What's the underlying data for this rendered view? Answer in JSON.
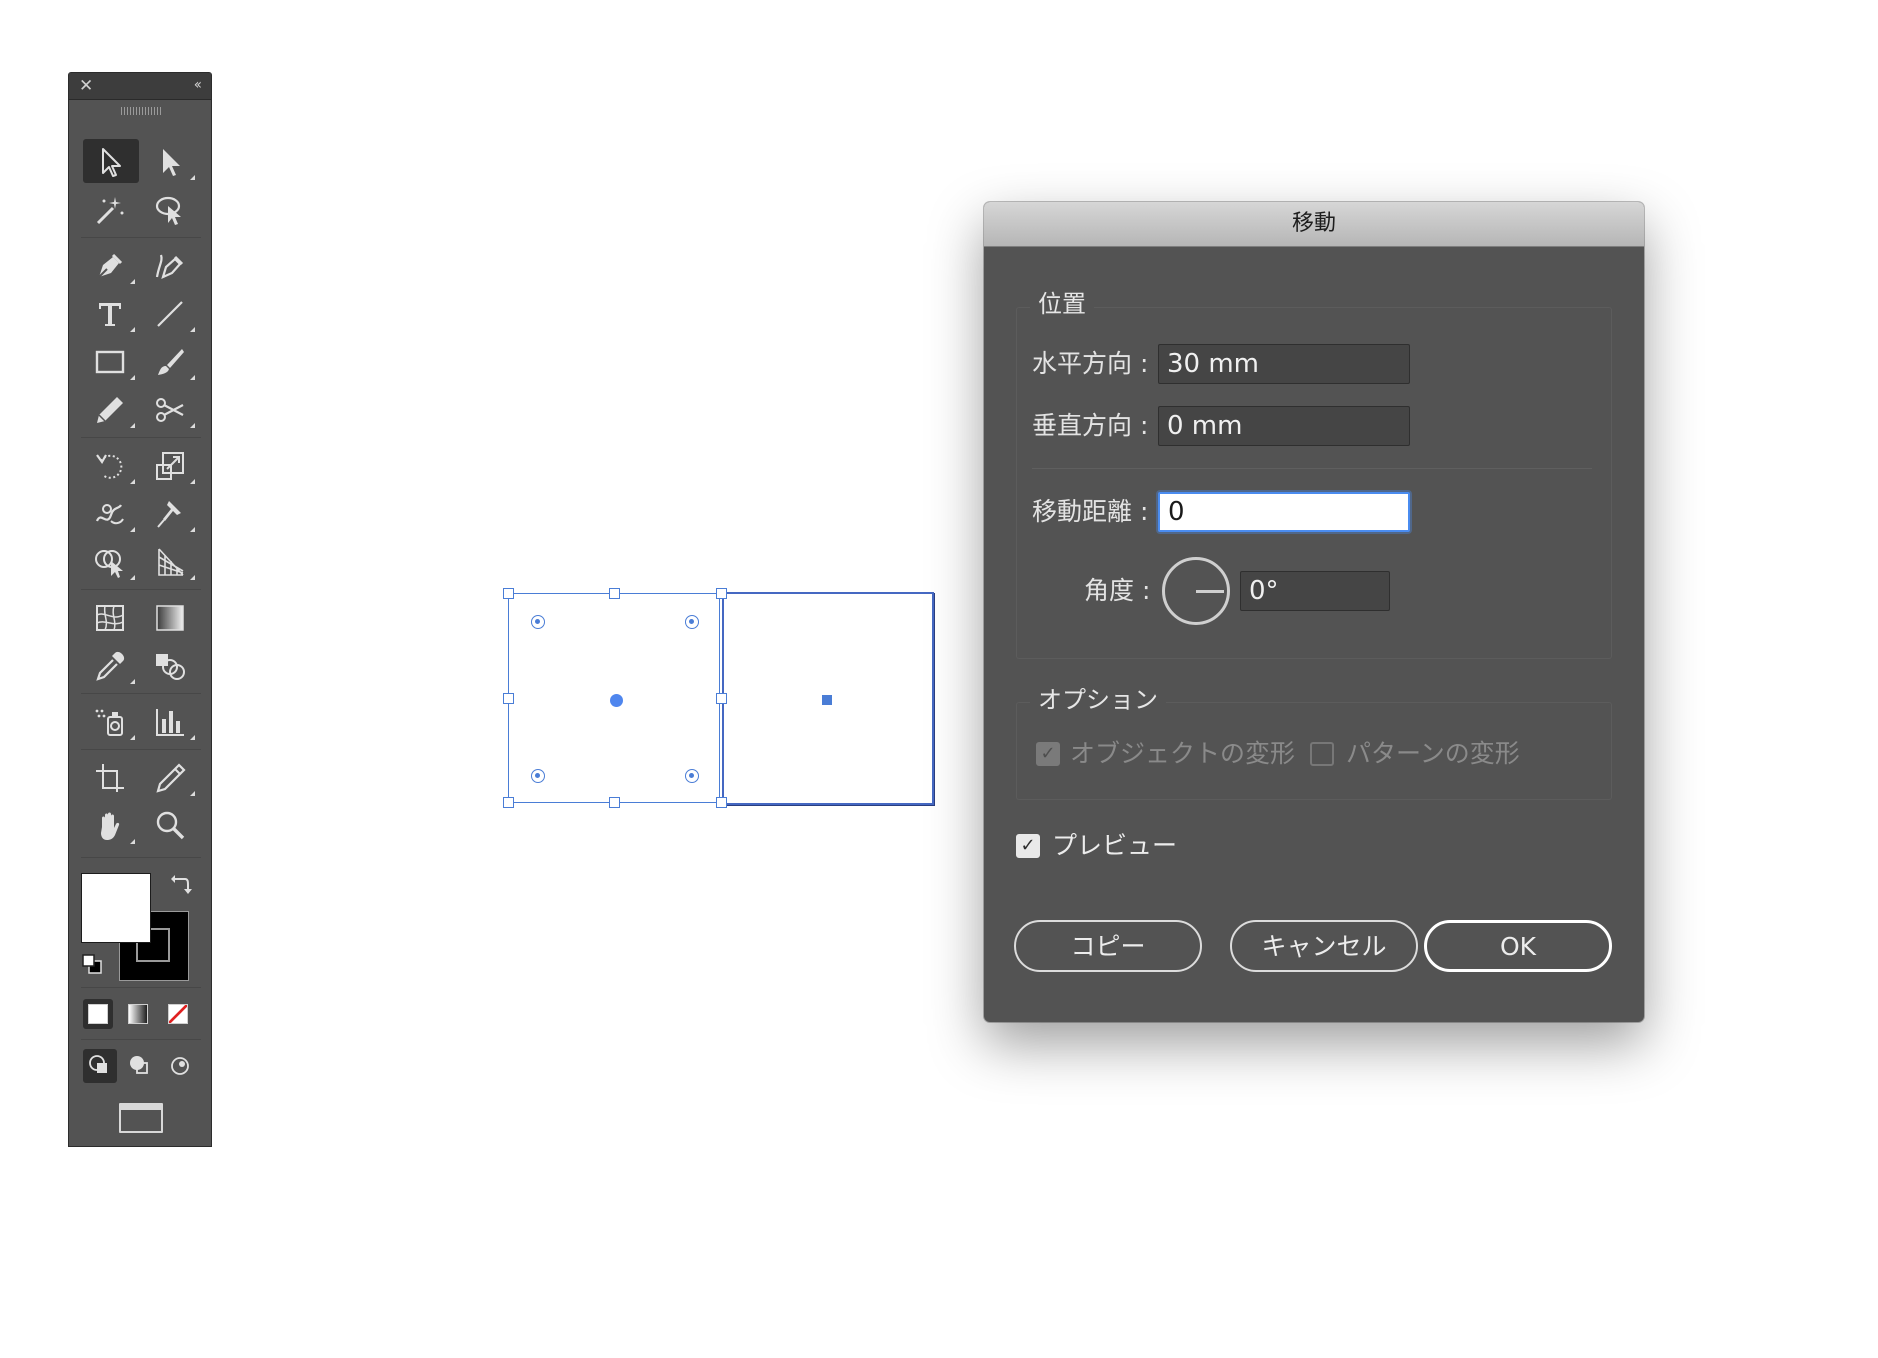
{
  "toolbar": {
    "close_glyph": "✕",
    "collapse_glyph": "‹‹",
    "tools": [
      {
        "name": "selection-tool-icon",
        "active": true
      },
      {
        "name": "direct-selection-tool-icon"
      },
      {
        "name": "magic-wand-tool-icon"
      },
      {
        "name": "lasso-tool-icon"
      },
      {
        "name": "pen-tool-icon"
      },
      {
        "name": "curvature-tool-icon"
      },
      {
        "name": "type-tool-icon"
      },
      {
        "name": "line-segment-tool-icon"
      },
      {
        "name": "rectangle-tool-icon"
      },
      {
        "name": "paintbrush-tool-icon"
      },
      {
        "name": "pencil-tool-icon"
      },
      {
        "name": "scissors-tool-icon"
      },
      {
        "name": "rotate-tool-icon"
      },
      {
        "name": "scale-tool-icon"
      },
      {
        "name": "warp-tool-icon"
      },
      {
        "name": "puppet-warp-tool-icon"
      },
      {
        "name": "shape-builder-tool-icon"
      },
      {
        "name": "perspective-grid-tool-icon"
      },
      {
        "name": "mesh-tool-icon"
      },
      {
        "name": "gradient-tool-icon"
      },
      {
        "name": "eyedropper-tool-icon"
      },
      {
        "name": "blend-tool-icon"
      },
      {
        "name": "symbol-sprayer-tool-icon"
      },
      {
        "name": "column-graph-tool-icon"
      },
      {
        "name": "artboard-tool-icon"
      },
      {
        "name": "slice-tool-icon"
      },
      {
        "name": "hand-tool-icon"
      },
      {
        "name": "zoom-tool-icon"
      }
    ],
    "fill_color": "#ffffff",
    "stroke_color": "#000000",
    "none_glyph": "⁄"
  },
  "dialog": {
    "title": "移動",
    "position_group": {
      "legend": "位置",
      "horizontal_label": "水平方向 :",
      "horizontal_value": "30 mm",
      "vertical_label": "垂直方向 :",
      "vertical_value": "0 mm",
      "distance_label": "移動距離 :",
      "distance_value": "0",
      "angle_label": "角度 :",
      "angle_value": "0°"
    },
    "options_group": {
      "legend": "オプション",
      "transform_objects_label": "オブジェクトの変形",
      "transform_objects_checked": true,
      "transform_patterns_label": "パターンの変形",
      "transform_patterns_checked": false
    },
    "preview_label": "プレビュー",
    "preview_checked": true,
    "check_glyph": "✓",
    "copy_button": "コピー",
    "cancel_button": "キャンセル",
    "ok_button": "OK"
  },
  "colors": {
    "selection_blue": "#4a7dd6",
    "dialog_bg": "#535353",
    "focus_ring": "#4a8cf0"
  }
}
